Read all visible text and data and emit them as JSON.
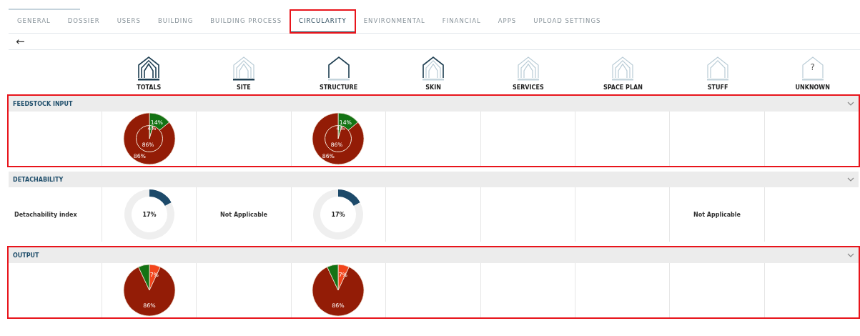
{
  "tabs": [
    {
      "label": "GENERAL",
      "selected": false,
      "highlighted": false
    },
    {
      "label": "DOSSIER",
      "selected": false,
      "highlighted": false
    },
    {
      "label": "USERS",
      "selected": false,
      "highlighted": false
    },
    {
      "label": "BUILDING",
      "selected": false,
      "highlighted": false
    },
    {
      "label": "BUILDING PROCESS",
      "selected": false,
      "highlighted": false
    },
    {
      "label": "CIRCULARITY",
      "selected": true,
      "highlighted": true
    },
    {
      "label": "ENVIRONMENTAL",
      "selected": false,
      "highlighted": false
    },
    {
      "label": "FINANCIAL",
      "selected": false,
      "highlighted": false
    },
    {
      "label": "APPS",
      "selected": false,
      "highlighted": false
    },
    {
      "label": "UPLOAD SETTINGS",
      "selected": false,
      "highlighted": false
    }
  ],
  "back_button": "←",
  "categories": [
    {
      "label": "TOTALS",
      "kind": "totals"
    },
    {
      "label": "SITE",
      "kind": "site"
    },
    {
      "label": "STRUCTURE",
      "kind": "structure"
    },
    {
      "label": "SKIN",
      "kind": "skin"
    },
    {
      "label": "SERVICES",
      "kind": "services"
    },
    {
      "label": "SPACE PLAN",
      "kind": "space"
    },
    {
      "label": "STUFF",
      "kind": "stuff"
    },
    {
      "label": "UNKNOWN",
      "kind": "unknown",
      "icon_text": "?"
    }
  ],
  "sections": [
    {
      "title": "FEEDSTOCK INPUT",
      "highlighted": true,
      "expanded": true,
      "rows": [
        {
          "cells": [
            {
              "kind": "pie",
              "chart_data": {
                "type": "pie",
                "values": [
                  14,
                  86
                ],
                "value_labels": [
                  "14%",
                  "86%"
                ],
                "colors": [
                  "#147314",
                  "#931c06"
                ]
              },
              "inner": {
                "chart_data": {
                  "type": "pie",
                  "values": [
                    4,
                    86
                  ],
                  "value_labels": [
                    "4%",
                    "86%"
                  ],
                  "colors": [
                    "#147314",
                    "#931c06"
                  ]
                }
              }
            },
            {
              "kind": "empty"
            },
            {
              "kind": "pie",
              "chart_data": {
                "type": "pie",
                "values": [
                  14,
                  86
                ],
                "value_labels": [
                  "14%",
                  "86%"
                ],
                "colors": [
                  "#147314",
                  "#931c06"
                ]
              },
              "inner": {
                "chart_data": {
                  "type": "pie",
                  "values": [
                    4,
                    86
                  ],
                  "value_labels": [
                    "4%",
                    "86%"
                  ],
                  "colors": [
                    "#147314",
                    "#931c06"
                  ]
                }
              }
            },
            {
              "kind": "empty"
            },
            {
              "kind": "empty"
            },
            {
              "kind": "empty"
            },
            {
              "kind": "empty"
            },
            {
              "kind": "empty"
            }
          ]
        }
      ]
    },
    {
      "title": "DETACHABILITY",
      "highlighted": false,
      "expanded": true,
      "rows": [
        {
          "label": "Detachability index",
          "cells": [
            {
              "kind": "donut",
              "chart_data": {
                "type": "donut",
                "values": [
                  17,
                  83
                ],
                "colors": [
                  "#1d4a6a",
                  "#efefef"
                ]
              },
              "reading": "17%"
            },
            {
              "kind": "text",
              "text": "Not Applicable"
            },
            {
              "kind": "donut",
              "chart_data": {
                "type": "donut",
                "values": [
                  17,
                  83
                ],
                "colors": [
                  "#1d4a6a",
                  "#efefef"
                ]
              },
              "reading": "17%"
            },
            {
              "kind": "empty"
            },
            {
              "kind": "empty"
            },
            {
              "kind": "empty"
            },
            {
              "kind": "text",
              "text": "Not Applicable"
            },
            {
              "kind": "empty"
            }
          ]
        }
      ]
    },
    {
      "title": "OUTPUT",
      "highlighted": true,
      "expanded": true,
      "rows": [
        {
          "cells": [
            {
              "kind": "pie",
              "chart_data": {
                "type": "pie",
                "values": [
                  7,
                  86,
                  7
                ],
                "value_labels": [
                  "7%",
                  "86%",
                  null
                ],
                "colors": [
                  "#f2451c",
                  "#931c06",
                  "#147314"
                ]
              }
            },
            {
              "kind": "empty"
            },
            {
              "kind": "pie",
              "chart_data": {
                "type": "pie",
                "values": [
                  7,
                  86,
                  7
                ],
                "value_labels": [
                  "7%",
                  "86%",
                  null
                ],
                "colors": [
                  "#f2451c",
                  "#931c06",
                  "#147314"
                ]
              }
            },
            {
              "kind": "empty"
            },
            {
              "kind": "empty"
            },
            {
              "kind": "empty"
            },
            {
              "kind": "empty"
            },
            {
              "kind": "empty"
            }
          ]
        }
      ]
    }
  ]
}
